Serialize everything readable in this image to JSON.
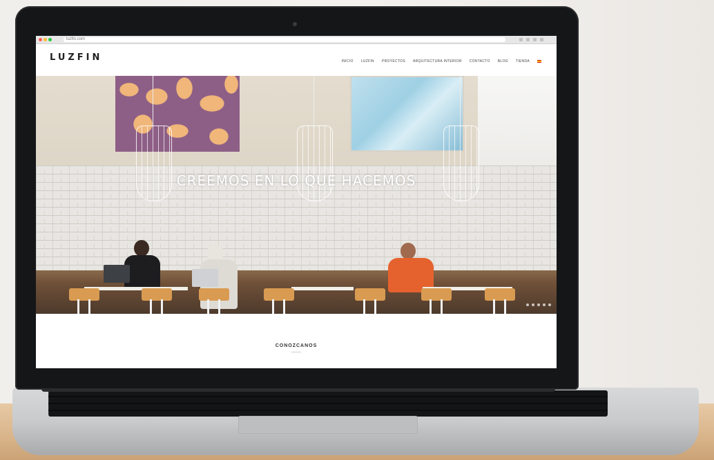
{
  "browser": {
    "address": "luzfin.com"
  },
  "site": {
    "logo": "LUZFIN",
    "logo_sub": "",
    "nav": [
      {
        "label": "INICIO"
      },
      {
        "label": "LUZFIN"
      },
      {
        "label": "PROYECTOS"
      },
      {
        "label": "ARQUITECTURA INTERIOR"
      },
      {
        "label": "CONTACTO"
      },
      {
        "label": "BLOG"
      },
      {
        "label": "TIENDA"
      }
    ]
  },
  "hero": {
    "title": "CREEMOS EN LO QUE HACEMOS"
  },
  "section": {
    "title": "CONOZCANOS"
  },
  "colors": {
    "wall": "#f2f0ed",
    "desk": "#d9b48a",
    "laptop_bezel": "#151617",
    "art_purple": "#8e5f86",
    "art_orange": "#f0b67a",
    "chair": "#d99b52"
  },
  "icons": [
    "camera-icon",
    "spanish-flag-icon"
  ]
}
